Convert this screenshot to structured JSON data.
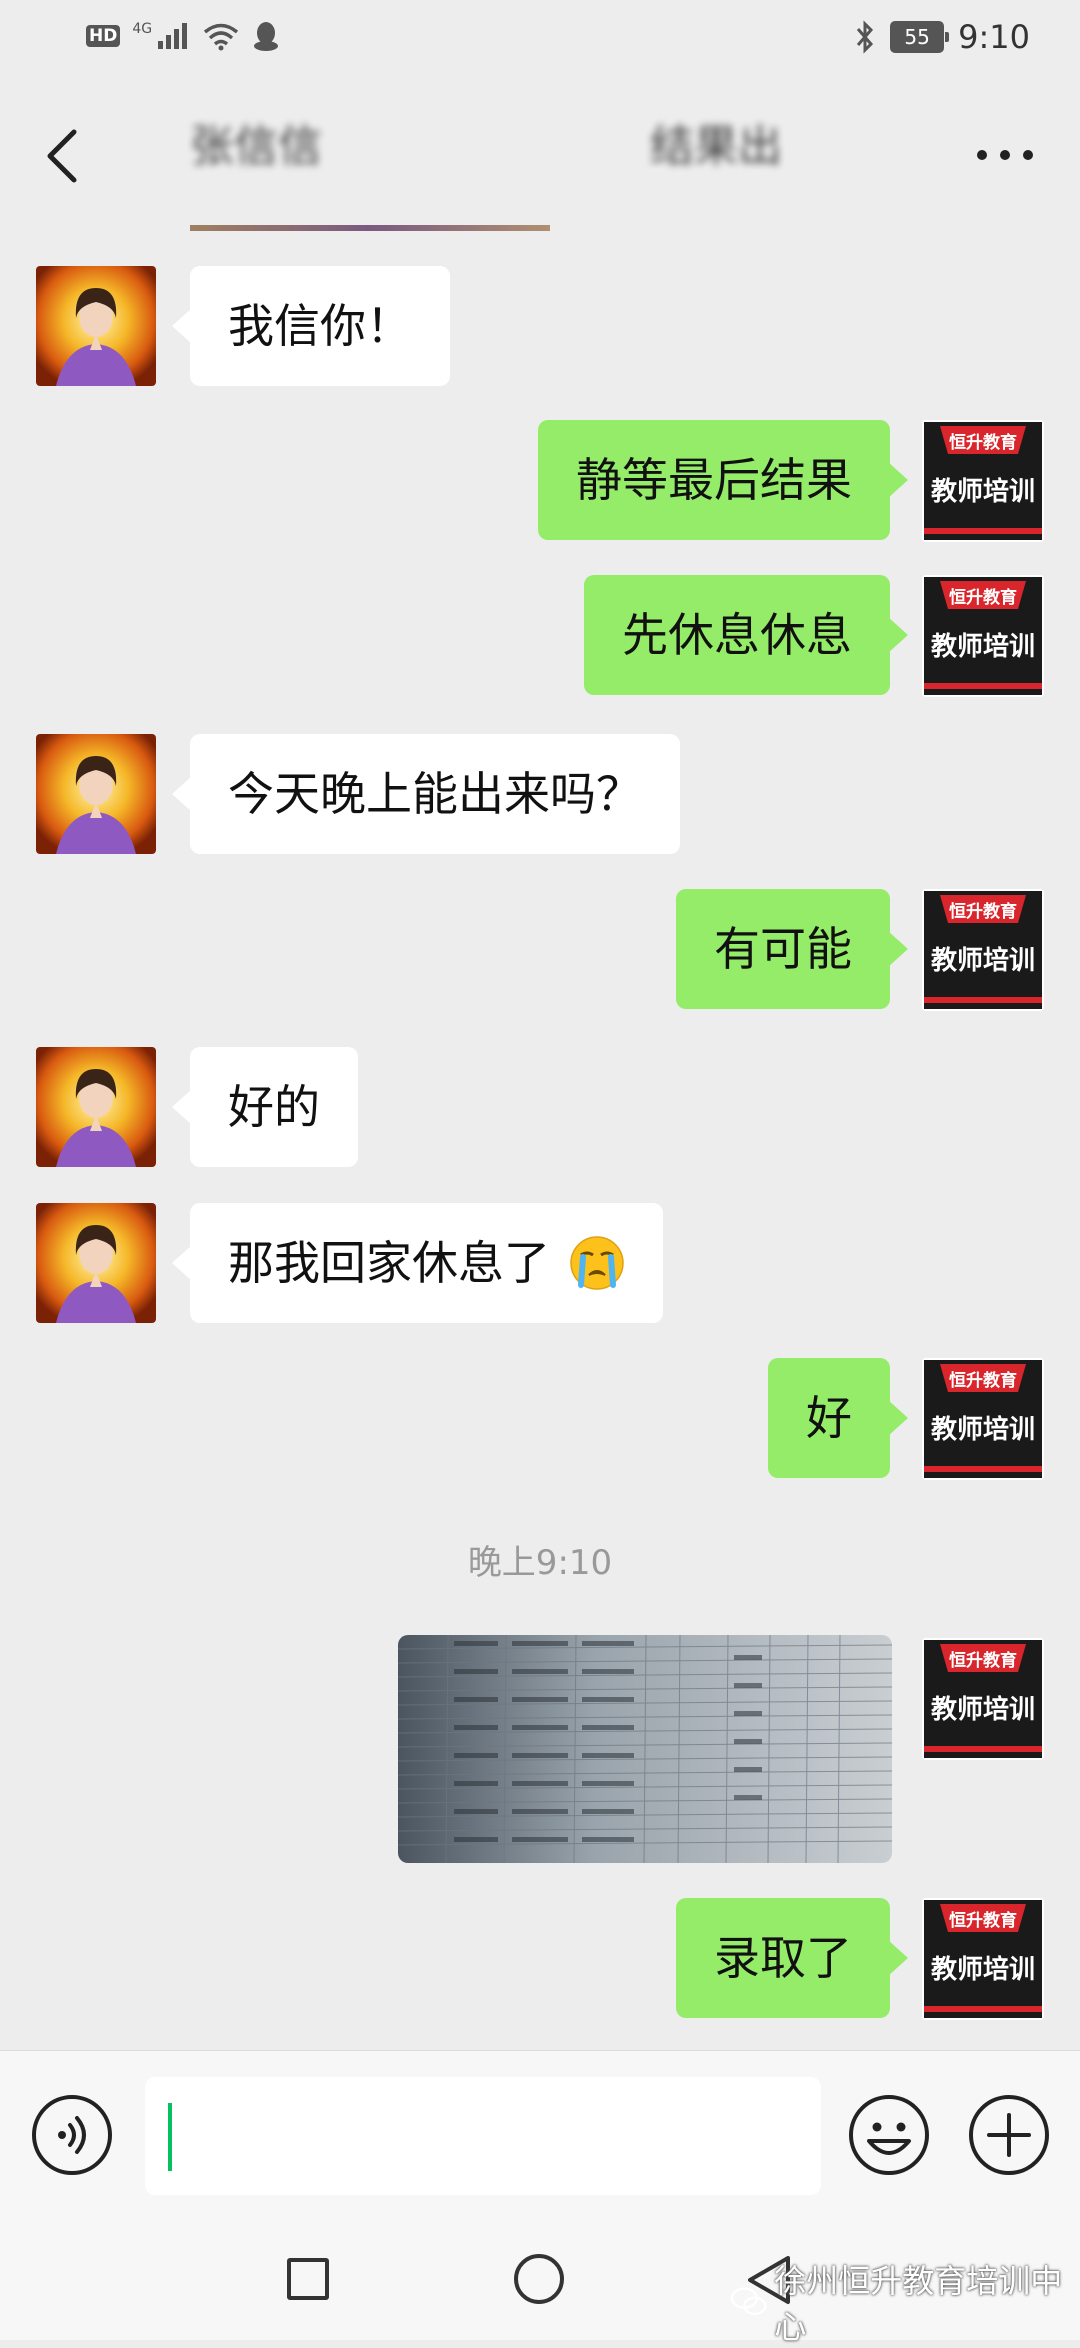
{
  "status_bar": {
    "hd_badge": "HD",
    "network": "4G",
    "battery": "55",
    "time": "9:10"
  },
  "header": {
    "title": "张信信",
    "title_tail": "结果出"
  },
  "messages": [
    {
      "side": "left",
      "text": "我信你！"
    },
    {
      "side": "right",
      "text": "静等最后结果"
    },
    {
      "side": "right",
      "text": "先休息休息"
    },
    {
      "side": "left",
      "text": "今天晚上能出来吗？"
    },
    {
      "side": "right",
      "text": "有可能"
    },
    {
      "side": "left",
      "text": "好的"
    },
    {
      "side": "left",
      "text": "那我回家休息了"
    },
    {
      "side": "right",
      "text": "好"
    },
    {
      "side": "right",
      "text": "录取了"
    }
  ],
  "timestamp": "晚上9:10",
  "avatar_badge": {
    "top": "恒升教育",
    "bottom": "教师培训"
  },
  "watermark": "徐州恒升教育培训中心",
  "colors": {
    "sent_bubble": "#95ec69",
    "received_bubble": "#ffffff",
    "background": "#ededed",
    "badge_red": "#d9262c"
  }
}
